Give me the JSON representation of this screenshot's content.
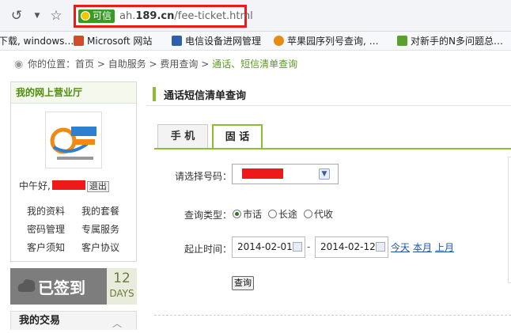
{
  "browser": {
    "trust_label": "可信",
    "url_prefix": "ah.",
    "url_domain": "189.cn",
    "url_path": "/fee-ticket.html"
  },
  "bookmarks": [
    {
      "label": "下载, windows…",
      "color": "#4b7cc9"
    },
    {
      "label": "Microsoft 网站",
      "color": "#d64a2c"
    },
    {
      "label": "电信设备进网管理",
      "color": "#2e5fae"
    },
    {
      "label": "苹果园序列号查询, …",
      "color": "#e88b12"
    },
    {
      "label": "对新手的N多问题总…",
      "color": "#5aa02c"
    }
  ],
  "breadcrumb": {
    "prefix": "你的位置：",
    "items": [
      "首页",
      "自助服务",
      "费用查询",
      "通话、短信清单查询"
    ],
    "separator": " > "
  },
  "sidebar": {
    "title": "我的网上营业厅",
    "greeting": "中午好,",
    "logout": "退出",
    "links": [
      "我的资料",
      "我的套餐",
      "密码管理",
      "专属服务",
      "客户须知",
      "客户协议"
    ],
    "signin_label": "已签到",
    "signin_days": "12",
    "signin_unit": "DAYS",
    "trade_title": "我的交易"
  },
  "main": {
    "title": "通话短信清单查询",
    "tabs": [
      {
        "label": "手 机",
        "active": false
      },
      {
        "label": "固 话",
        "active": true
      }
    ],
    "select_label": "请选择号码：",
    "query_type_label": "查询类型：",
    "query_types": [
      {
        "label": "市话",
        "checked": true
      },
      {
        "label": "长途",
        "checked": false
      },
      {
        "label": "代收",
        "checked": false
      }
    ],
    "period_label": "起止时间：",
    "start_date": "2014-02-01",
    "end_date": "2014-02-12",
    "quick_links": [
      "今天",
      "本月",
      "上月"
    ],
    "query_button": "查询"
  },
  "colors": {
    "accent": "#8bbf2f",
    "highlight": "#ee1a1a",
    "link": "#1a55b5"
  }
}
